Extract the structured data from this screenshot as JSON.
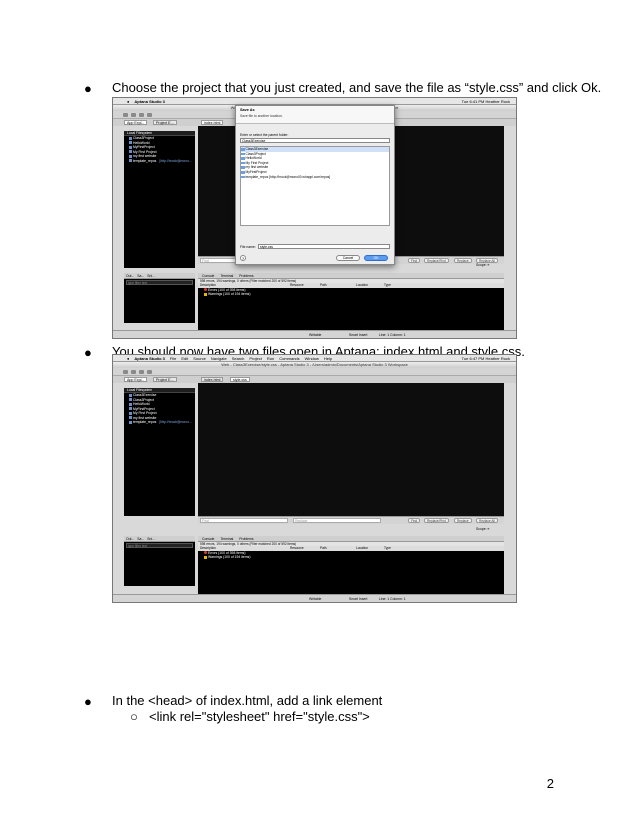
{
  "bullets": [
    {
      "marker": "●",
      "text": "Choose the project that you just created, and save the file as “style.css” and click Ok."
    },
    {
      "marker": "●",
      "text": "You should now have two files open in Aptana: index.html and style.css."
    },
    {
      "marker": "●",
      "text": "In the <head> of index.html, add a link element"
    }
  ],
  "subbullet": {
    "marker": "○",
    "text": "<link rel=\"stylesheet\" href=\"style.css\">"
  },
  "page_number": "2",
  "screenshot1": {
    "app_name": "Aptana Studio 3",
    "clock": "Tue 6:41 PM",
    "user": "Heather Rock",
    "window_title": "Web - Untitled CSS1 - Aptana Studio 3 - /Users/admin/Documents/Aptana Studio 3 Workspace",
    "tabs": [
      "App Expl...",
      "Project E...",
      "index.html"
    ],
    "panel_header": "Local Filesystem",
    "tree": [
      {
        "label": "Class3Project",
        "extra": ""
      },
      {
        "label": "HelloWorld",
        "extra": ""
      },
      {
        "label": "MyFirstProject",
        "extra": ""
      },
      {
        "label": "My First Project",
        "extra": ""
      },
      {
        "label": "my first website",
        "extra": ""
      },
      {
        "label": "template_repos",
        "extra": "[http://hrock@mono..."
      }
    ],
    "dialog": {
      "title": "Save As",
      "subtitle": "Save file to another location.",
      "folder_label": "Enter or select the parent folder:",
      "folder_value": "Class3Exercise",
      "items": [
        "Class3Exercise",
        "Class3Project",
        "HelloWorld",
        "My First Project",
        "my first website",
        "MyFirstProject",
        "template_repos [http://hrock@mono00.whappl.com/repos]"
      ],
      "file_label": "File name:",
      "file_value": "style.css",
      "cancel": "Cancel",
      "ok": "OK",
      "help": "?"
    },
    "find_placeholder": "Find",
    "find_buttons": [
      "Find",
      "Replace/Find",
      "Replace",
      "Replace All"
    ],
    "scope": "Scope: ≡",
    "bottom_tabs_left": [
      "Out...",
      "Sa...",
      "Sni..."
    ],
    "filter_placeholder": "type filter text",
    "bottom_tabs": [
      "Console",
      "Terminal",
      "Problems"
    ],
    "problems_summary": "598 errors, 194 warnings, 0 others (Filter matched 200 of 592 items)",
    "columns": [
      "Description",
      "Resource",
      "Path",
      "Location",
      "Type"
    ],
    "problem_rows": [
      "Errors (100 of 398 items)",
      "Warnings (100 of 194 items)"
    ],
    "status": [
      "Writable",
      "Smart Insert",
      "Line: 1 Column: 1"
    ]
  },
  "screenshot2": {
    "app_name": "Aptana Studio 3",
    "menu": [
      "File",
      "Edit",
      "Source",
      "Navigate",
      "Search",
      "Project",
      "Run",
      "Commands",
      "Window",
      "Help"
    ],
    "clock": "Tue 6:47 PM",
    "user": "Heather Rock",
    "window_title": "Web - Class3Exercise/style.css - Aptana Studio 3 - /Users/admin/Documents/Aptana Studio 3 Workspace",
    "tabs": [
      "App Expl...",
      "Project E...",
      "index.html",
      "style.css"
    ],
    "panel_header": "Local Filesystem",
    "tree": [
      {
        "label": "Class3Exercise",
        "extra": ""
      },
      {
        "label": "Class3Project",
        "extra": ""
      },
      {
        "label": "HelloWorld",
        "extra": ""
      },
      {
        "label": "MyFirstProject",
        "extra": ""
      },
      {
        "label": "My First Project",
        "extra": ""
      },
      {
        "label": "my first website",
        "extra": ""
      },
      {
        "label": "template_repos",
        "extra": "[http://hrock@mono..."
      }
    ],
    "find_placeholder": "Find",
    "replace_placeholder": "Replace",
    "find_buttons": [
      "Find",
      "Replace/Find",
      "Replace",
      "Replace All"
    ],
    "scope": "Scope: ≡",
    "bottom_tabs_left": [
      "Out...",
      "Sa...",
      "Sni..."
    ],
    "filter_placeholder": "type filter text",
    "bottom_tabs": [
      "Console",
      "Terminal",
      "Problems"
    ],
    "problems_summary": "598 errors, 194 warnings, 0 others (Filter matched 200 of 592 items)",
    "columns": [
      "Description",
      "Resource",
      "Path",
      "Location",
      "Type"
    ],
    "problem_rows": [
      "Errors (100 of 398 items)",
      "Warnings (100 of 194 items)"
    ],
    "status": [
      "Writable",
      "Smart Insert",
      "Line: 1 Column: 1"
    ]
  }
}
